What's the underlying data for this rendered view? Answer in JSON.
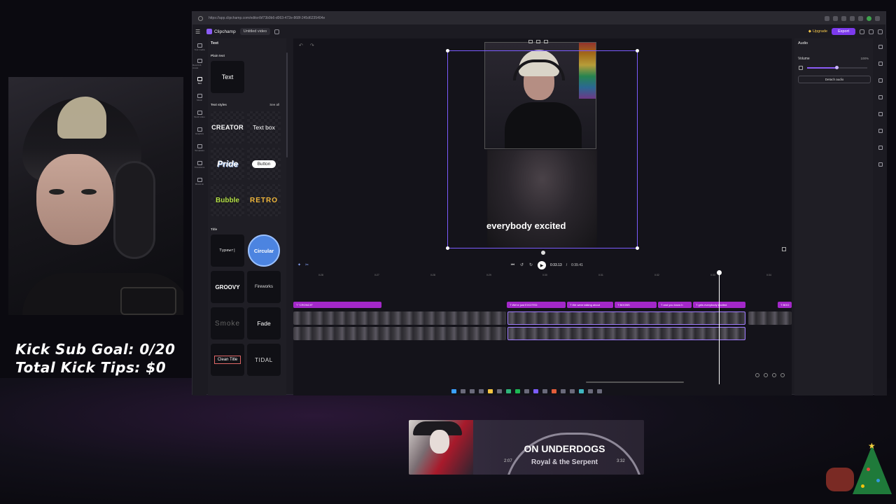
{
  "overlay": {
    "sub_goal": "Kick Sub Goal: 0/20",
    "tips": "Total Kick Tips: $0"
  },
  "browser": {
    "url": "https://app.clipchamp.com/editor/bf73b9b6-d063-472e-868f-245d6235404e"
  },
  "app": {
    "brand": "Clipchamp",
    "project_title": "Untitled video",
    "upgrade_label": "Upgrade",
    "export_label": "Export"
  },
  "rail": {
    "items": [
      {
        "label": "Your media",
        "icon": "folder-icon"
      },
      {
        "label": "Record & create",
        "icon": "camera-icon"
      },
      {
        "label": "Text",
        "icon": "text-icon",
        "active": true
      },
      {
        "label": "Music",
        "icon": "music-icon"
      },
      {
        "label": "Stock video",
        "icon": "film-icon"
      },
      {
        "label": "Graphics",
        "icon": "shapes-icon"
      },
      {
        "label": "Templates",
        "icon": "grid-icon"
      },
      {
        "label": "Transitions",
        "icon": "transition-icon"
      },
      {
        "label": "Brand kit",
        "icon": "brand-icon"
      }
    ]
  },
  "panel": {
    "header": "Text",
    "plain_text_heading": "Plain text",
    "plain_text_tile": "Text",
    "text_styles_heading": "Text styles",
    "see_all": "See all",
    "styles": {
      "creator": "CREATOR",
      "textbox": "Text box",
      "pride": "Pride",
      "button": "Button",
      "bubble": "Bubble",
      "retro": "RETRO"
    },
    "title_heading": "Title",
    "titles": {
      "typewriter": "Typewr|",
      "circular": "Circular",
      "groovy": "GROOVY",
      "fireworks": "Fireworks",
      "smoke": "Smoke",
      "fade": "Fade",
      "clean": "Clean Title",
      "tidal": "TIDAL"
    }
  },
  "preview": {
    "caption": "everybody excited"
  },
  "playback": {
    "current": "0:33.13",
    "total": "0:39.41"
  },
  "timeline": {
    "ticks": [
      "0:28",
      "0:27",
      "0:28",
      "0:29",
      "0:30",
      "0:31",
      "0:32",
      "0:33",
      "0:34"
    ],
    "text_clips": [
      {
        "label": "T \"CRONCH\""
      },
      {
        "label": "T We're just EXCITED"
      },
      {
        "label": "T We were talking about"
      },
      {
        "label": "T BOOBS"
      },
      {
        "label": "T and you know h"
      },
      {
        "label": "T gets everybody excited"
      },
      {
        "label": "T BOO"
      }
    ]
  },
  "properties": {
    "tab": "Audio",
    "volume_label": "Volume",
    "volume_value": "100%",
    "volume_fraction": 0.49,
    "detach_label": "Detach audio"
  },
  "now_playing": {
    "title": "ON UNDERDOGS",
    "artist": "Royal & the Serpent",
    "elapsed": "2:07",
    "duration": "3:32"
  }
}
